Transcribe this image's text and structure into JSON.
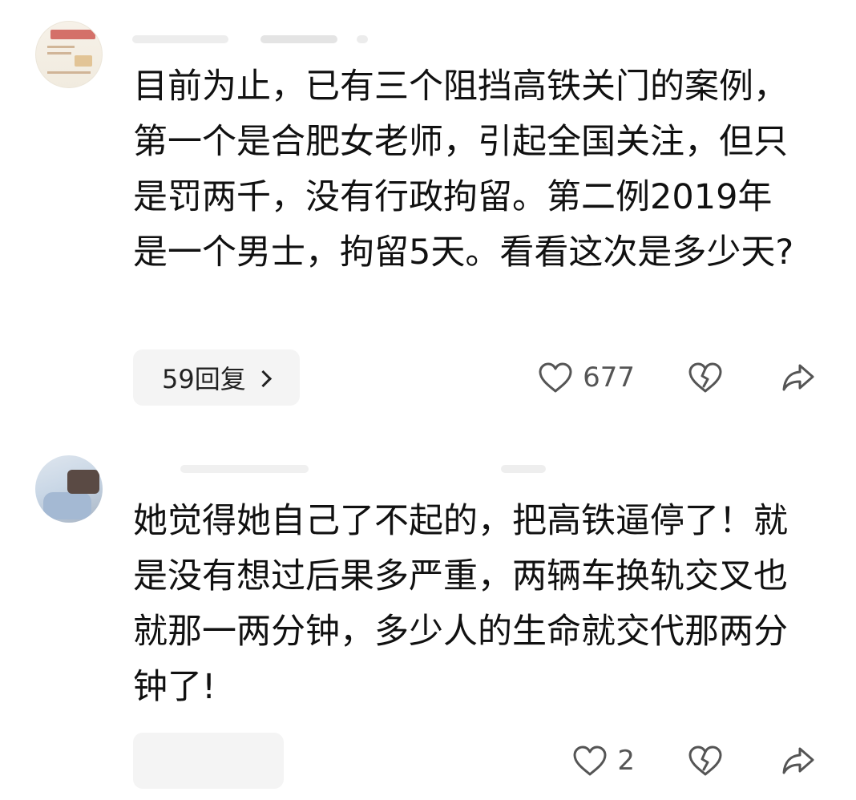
{
  "comments": [
    {
      "username": "",
      "text": "目前为止，已有三个阻挡高铁关门的案例，第一个是合肥女老师，引起全国关注，但只是罚两千，没有行政拘留。第二例2019年是一个男士，拘留5天。看看这次是多少天?",
      "reply_label": "59回复",
      "like_count": "677"
    },
    {
      "username": "",
      "text": "她觉得她自己了不起的，把高铁逼停了！就是没有想过后果多严重，两辆车换轨交叉也就那一两分钟，多少人的生命就交代那两分钟了!",
      "reply_label": "",
      "like_count": "2"
    }
  ],
  "icons": {
    "like": "heart-outline-icon",
    "dislike": "broken-heart-icon",
    "share": "share-arrow-icon",
    "chevron": "chevron-right-icon"
  },
  "colors": {
    "text": "#111111",
    "muted": "#555555",
    "pill_bg": "#f4f4f4",
    "icon": "#555555"
  }
}
